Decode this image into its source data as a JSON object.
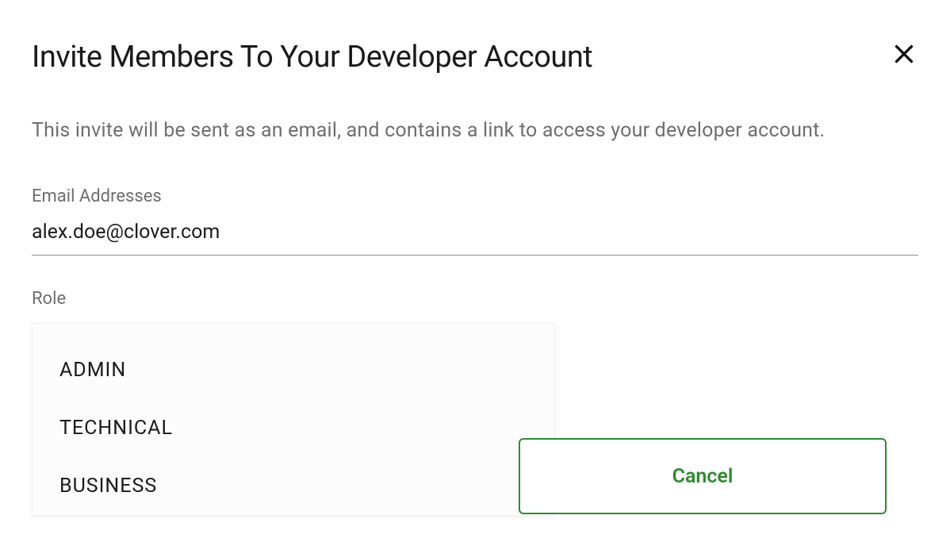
{
  "dialog": {
    "title": "Invite Members To Your Developer Account",
    "description": "This invite will be sent as an email, and contains a link to access your developer account."
  },
  "fields": {
    "email": {
      "label": "Email Addresses",
      "value": "alex.doe@clover.com"
    },
    "role": {
      "label": "Role",
      "options": [
        "ADMIN",
        "TECHNICAL",
        "BUSINESS"
      ]
    }
  },
  "buttons": {
    "cancel": "Cancel"
  }
}
